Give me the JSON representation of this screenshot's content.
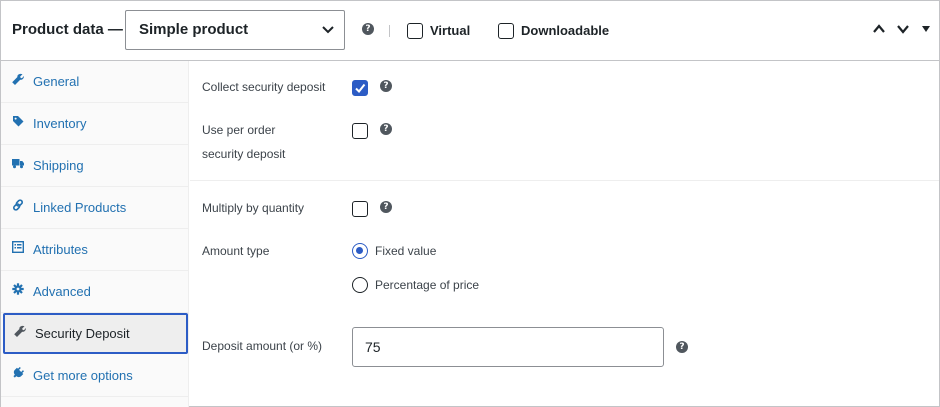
{
  "header": {
    "title": "Product data —",
    "product_type": {
      "selected": "Simple product",
      "icon": "chevron-down-icon"
    },
    "help_icon": "?",
    "virtual": {
      "label": "Virtual",
      "checked": false
    },
    "downloadable": {
      "label": "Downloadable",
      "checked": false
    },
    "move_up_icon": "chevron-up-icon",
    "move_down_icon": "chevron-down-icon",
    "toggle_icon": "triangle-down-icon"
  },
  "sidebar": {
    "items": [
      {
        "label": "General",
        "icon": "wrench-icon",
        "active": false
      },
      {
        "label": "Inventory",
        "icon": "tag-icon",
        "active": false
      },
      {
        "label": "Shipping",
        "icon": "truck-icon",
        "active": false
      },
      {
        "label": "Linked Products",
        "icon": "link-icon",
        "active": false
      },
      {
        "label": "Attributes",
        "icon": "list-icon",
        "active": false
      },
      {
        "label": "Advanced",
        "icon": "gear-icon",
        "active": false
      },
      {
        "label": "Security Deposit",
        "icon": "wrench-icon",
        "active": true
      },
      {
        "label": "Get more options",
        "icon": "plugin-icon",
        "active": false
      }
    ]
  },
  "deposit": {
    "collect": {
      "label": "Collect security deposit",
      "checked": true
    },
    "per_order": {
      "label_line1": "Use per order",
      "label_line2": "security deposit",
      "checked": false
    },
    "multiply": {
      "label": "Multiply by quantity",
      "checked": false
    },
    "amount_type": {
      "label": "Amount type",
      "options": [
        {
          "label": "Fixed value",
          "selected": true
        },
        {
          "label": "Percentage of price",
          "selected": false
        }
      ]
    },
    "amount": {
      "label": "Deposit amount (or %)",
      "value": "75"
    }
  },
  "colors": {
    "accent": "#2c5cc5",
    "link": "#2271b1",
    "border": "#c3c4c7",
    "help": "#50575e"
  }
}
